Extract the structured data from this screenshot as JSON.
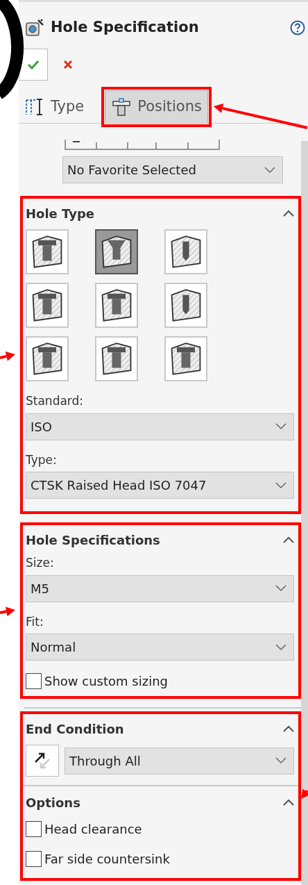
{
  "window": {
    "title": "Hole Specification"
  },
  "tabs": [
    {
      "label": "Type",
      "selected": false
    },
    {
      "label": "Positions",
      "selected": true
    }
  ],
  "favorites": {
    "value": "No Favorite Selected"
  },
  "hole_type": {
    "title": "Hole Type",
    "expanded": true,
    "types": [
      {
        "selected": false
      },
      {
        "selected": true
      },
      {
        "selected": false
      },
      {
        "selected": false
      },
      {
        "selected": false
      },
      {
        "selected": false
      },
      {
        "selected": false
      },
      {
        "selected": false
      },
      {
        "selected": false
      }
    ],
    "standard_label": "Standard:",
    "standard": "ISO",
    "type_label": "Type:",
    "type": "CTSK Raised Head ISO 7047"
  },
  "hole_specifications": {
    "title": "Hole Specifications",
    "expanded": true,
    "size_label": "Size:",
    "size": "M5",
    "fit_label": "Fit:",
    "fit": "Normal",
    "custom_sizing": {
      "label": "Show custom sizing",
      "checked": false
    }
  },
  "end_condition": {
    "title": "End Condition",
    "expanded": true,
    "value": "Through All"
  },
  "options": {
    "title": "Options",
    "expanded": true,
    "items": [
      {
        "label": "Head clearance",
        "checked": false
      },
      {
        "label": "Far side countersink",
        "checked": false
      }
    ]
  }
}
